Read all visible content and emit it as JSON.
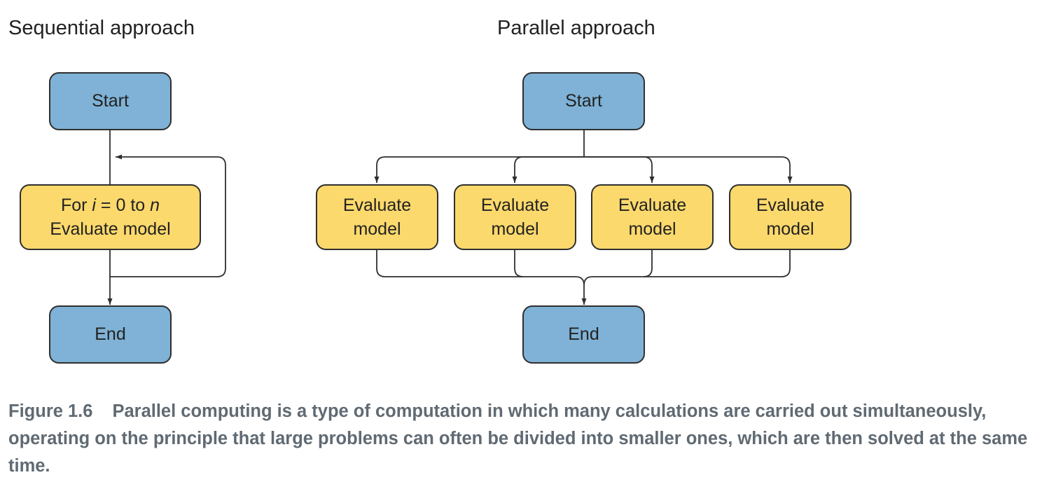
{
  "sequential": {
    "title": "Sequential approach",
    "start_label": "Start",
    "loop_label": {
      "line1_prefix": "For ",
      "line1_var_i": "i",
      "line1_middle": " = 0 to ",
      "line1_var_n": "n",
      "line2": "Evaluate model"
    },
    "end_label": "End"
  },
  "parallel": {
    "title": "Parallel approach",
    "start_label": "Start",
    "workers": [
      {
        "line1": "Evaluate",
        "line2": "model"
      },
      {
        "line1": "Evaluate",
        "line2": "model"
      },
      {
        "line1": "Evaluate",
        "line2": "model"
      },
      {
        "line1": "Evaluate",
        "line2": "model"
      }
    ],
    "end_label": "End"
  },
  "caption": {
    "figure_number": "Figure 1.6",
    "text": "Parallel computing is a type of computation in which many calculations are carried out simultaneously, operating on the principle that large problems can often be divided into smaller ones, which are then solved at the same time."
  },
  "colors": {
    "terminal_fill": "#7fb2d6",
    "process_fill": "#fcd96c",
    "line": "#2f2f2f",
    "caption_text": "#606a73"
  }
}
